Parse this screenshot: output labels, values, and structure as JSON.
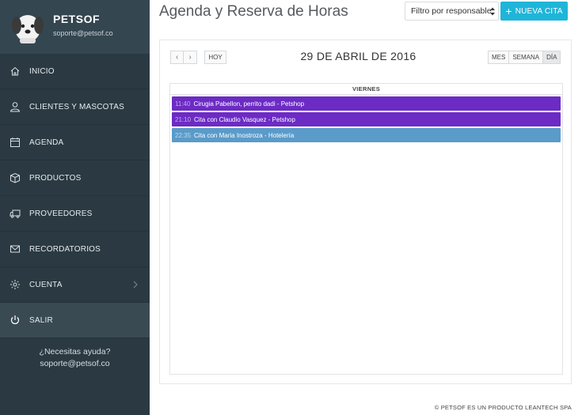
{
  "sidebar": {
    "brand": "PETSOF",
    "email": "soporte@petsof.co",
    "items": [
      {
        "label": "INICIO",
        "icon": "home-icon"
      },
      {
        "label": "CLIENTES Y MASCOTAS",
        "icon": "user-icon"
      },
      {
        "label": "AGENDA",
        "icon": "calendar-icon"
      },
      {
        "label": "PRODUCTOS",
        "icon": "box-icon"
      },
      {
        "label": "PROVEEDORES",
        "icon": "truck-icon"
      },
      {
        "label": "RECORDATORIOS",
        "icon": "envelope-icon"
      },
      {
        "label": "CUENTA",
        "icon": "gear-icon"
      },
      {
        "label": "SALIR",
        "icon": "power-icon"
      }
    ],
    "help_line1": "¿Necesitas ayuda?",
    "help_line2": "soporte@petsof.co"
  },
  "header": {
    "title": "Agenda y Reserva de Horas",
    "filter_label": "Filtro por responsable",
    "new_button": "NUEVA CITA"
  },
  "calendar": {
    "prev": "‹",
    "next": "›",
    "today": "HOY",
    "title": "29 DE ABRIL DE 2016",
    "views": [
      "MES",
      "SEMANA",
      "DÍA"
    ],
    "active_view": "DÍA",
    "day_header": "VIERNES",
    "events": [
      {
        "time": "11:40",
        "title": "Cirugia Pabellon, perrito dadi - Petshop",
        "color": "#6c2bc4"
      },
      {
        "time": "21:10",
        "title": "Cita con Claudio Vasquez - Petshop",
        "color": "#6c2bc4"
      },
      {
        "time": "22:35",
        "title": "Cita con Maria Inostroza - Hotelería",
        "color": "#5a9bc9"
      }
    ]
  },
  "footer": "© PETSOF ES UN PRODUCTO LEANTECH SPA",
  "colors": {
    "sidebar_bg": "#2b3a42",
    "accent": "#1fb5d8"
  }
}
